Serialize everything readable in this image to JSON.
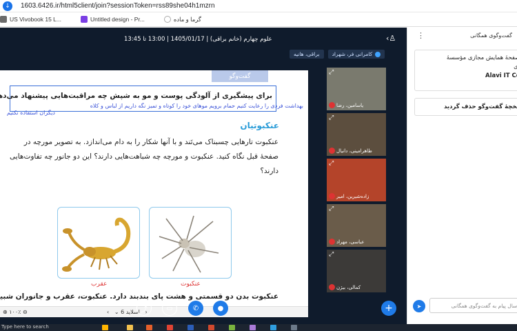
{
  "browser": {
    "url": "1603.6426.ir/html5client/join?sessionToken=rss89she04h1mzrn",
    "bookmarks": [
      "US Vivobook 15 L...",
      "Untitled design - Pr...",
      "گرما و ماده"
    ]
  },
  "meeting": {
    "title": "علوم چهارم (خانم براقی) | 1405/01/17 | 13:00 تا 13:45",
    "presenters": [
      "کامرانی فر، شهراد",
      "براقی، هانیه"
    ]
  },
  "slide": {
    "tag": "گفت‌وگو",
    "question": "برای پیشگیری از آلودگی پوست و مو به شپش چه مراقبت‌هایی پیشنهاد می‌دهید؟",
    "annotation_line1": "بهداشت فردی را رعایت کنیم حمام برویم موهای خود را کوتاه و تمیز نگه داریم از لباس و کلاه",
    "annotation_line2": "دیگران استفاده نکنیم",
    "heading": "عنکبوتیان",
    "paragraph": "عنکبوت تارهایی چسبناک می‌تَند و با آنها شکار را به دام می‌اندازد. به تصویر مورچه در صفحهٔ قبل نگاه کنید. عنکبوت و مورچه چه شباهت‌هایی دارند؟ این دو جانور چه تفاوت‌هایی دارند؟",
    "caption_scorpion": "عقرب",
    "caption_spider": "عنکبوت",
    "bottom_text": "عنکبوت بدن دو قسمتی و هشت پای بندبند دارد. عنکبوت، عقرب و جانوران شبیه آنها",
    "zoom": "۱۰۰٪",
    "page_label": "اسلاید 6"
  },
  "videos": [
    "یاسامین، رضا",
    "طاهرامینی، دانیال",
    "زاده‌شیرین، امیر",
    "عباسی، مهراد",
    "کمالی، بیژن"
  ],
  "chat": {
    "header": "گفت‌وگوی همگانی",
    "welcome_line1": "به صفحهٔ همایش مجازی مؤسسهٔ",
    "welcome_line2": "علوی",
    "welcome_line3": "Alavi IT Center",
    "cleared": "تاریخچهٔ گفت‌وگو حذف گردید",
    "input_placeholder": "ارسال پیام به گفت‌وگوی همگانی"
  },
  "taskbar": {
    "search": "Type here to search"
  },
  "colors": {
    "accent": "#1f7be8",
    "main_bg": "#0f1b2c",
    "heading": "#2a9cd8",
    "annotation": "#3a52d8"
  }
}
